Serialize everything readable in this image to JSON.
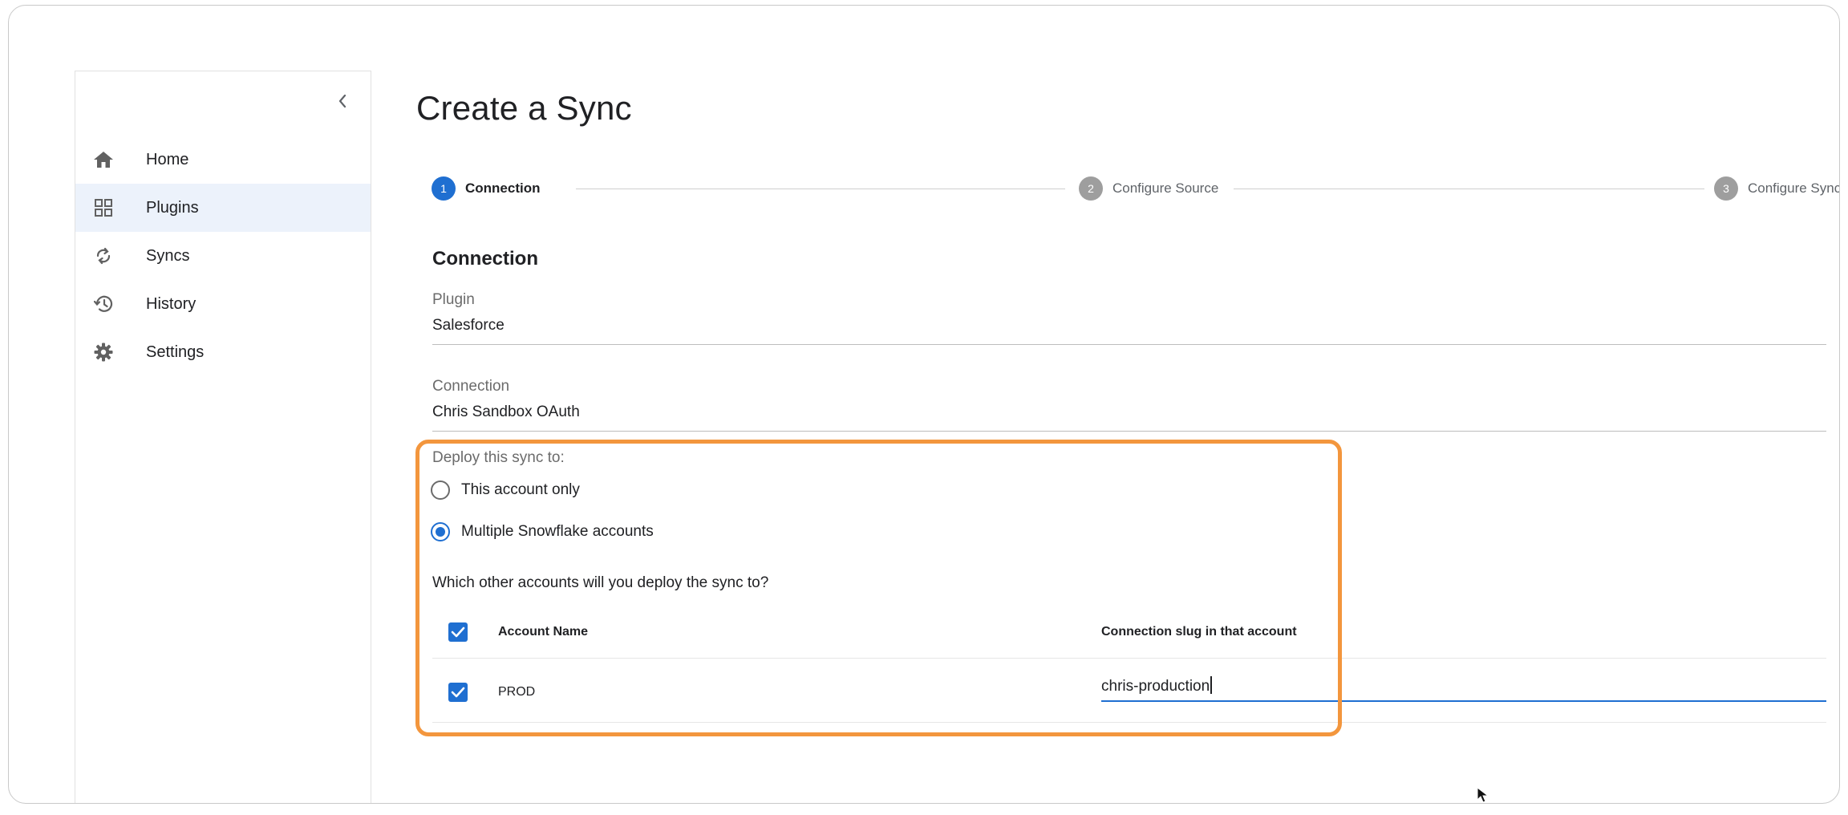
{
  "sidebar": {
    "collapse_icon": "chevron-left-icon",
    "items": [
      {
        "label": "Home",
        "icon": "home-icon",
        "active": false
      },
      {
        "label": "Plugins",
        "icon": "grid-icon",
        "active": true
      },
      {
        "label": "Syncs",
        "icon": "sync-icon",
        "active": false
      },
      {
        "label": "History",
        "icon": "history-icon",
        "active": false
      },
      {
        "label": "Settings",
        "icon": "gear-icon",
        "active": false
      }
    ]
  },
  "page": {
    "title": "Create a Sync"
  },
  "stepper": {
    "steps": [
      {
        "number": "1",
        "label": "Connection",
        "active": true
      },
      {
        "number": "2",
        "label": "Configure Source",
        "active": false
      },
      {
        "number": "3",
        "label": "Configure Sync",
        "active": false
      }
    ]
  },
  "form": {
    "section_title": "Connection",
    "plugin": {
      "label": "Plugin",
      "value": "Salesforce"
    },
    "connection": {
      "label": "Connection",
      "value": "Chris Sandbox OAuth"
    },
    "deploy": {
      "label": "Deploy this sync to:",
      "options": [
        {
          "label": "This account only",
          "selected": false
        },
        {
          "label": "Multiple Snowflake accounts",
          "selected": true
        }
      ]
    },
    "question": "Which other accounts will you deploy the sync to?",
    "table": {
      "headers": {
        "account_name": "Account Name",
        "connection_slug": "Connection slug in that account"
      },
      "select_all_checked": true,
      "rows": [
        {
          "account_name": "PROD",
          "checked": true,
          "connection_slug": "chris-production"
        }
      ]
    }
  },
  "colors": {
    "accent": "#1f6fd1",
    "highlight": "#f3963d",
    "active_nav_bg": "#ecf2fb",
    "inactive_step": "#9e9e9e"
  }
}
